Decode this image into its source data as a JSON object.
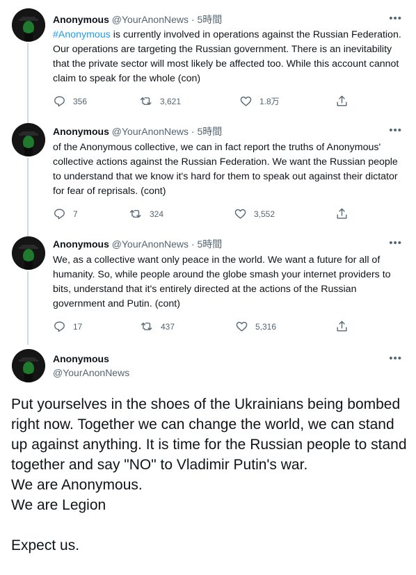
{
  "tweets": [
    {
      "name": "Anonymous",
      "handle": "@YourAnonNews",
      "sep": "·",
      "time": "5時間",
      "hashtag": "#Anonymous",
      "text": " is currently involved in operations against the Russian Federation. Our operations are targeting the Russian government. There is an inevitability that the private sector will most likely be affected too. While this account cannot claim to speak for the whole (con)",
      "replies": "356",
      "retweets": "3,621",
      "likes": "1.8万"
    },
    {
      "name": "Anonymous",
      "handle": "@YourAnonNews",
      "sep": "·",
      "time": "5時間",
      "text": "of the Anonymous collective, we can in fact report the truths of Anonymous' collective actions against the Russian Federation.  We want the Russian people to understand that we know it's hard for them to speak out against their dictator for fear of reprisals. (cont)",
      "replies": "7",
      "retweets": "324",
      "likes": "3,552"
    },
    {
      "name": "Anonymous",
      "handle": "@YourAnonNews",
      "sep": "·",
      "time": "5時間",
      "text": "We, as a collective want only peace in the world.  We want a future for all of humanity.  So, while people around the globe smash your internet providers to bits, understand that it's entirely directed at the actions of the Russian government and Putin. (cont)",
      "replies": "17",
      "retweets": "437",
      "likes": "5,316"
    }
  ],
  "main_tweet": {
    "name": "Anonymous",
    "handle": "@YourAnonNews",
    "lines": [
      "Put yourselves in the shoes of the Ukrainians being bombed right now.  Together we can change the world, we can stand up against anything.  It is time for the Russian people to stand together and say \"NO\" to Vladimir Putin's war.",
      "We are Anonymous.",
      "We are Legion",
      "",
      "Expect us."
    ]
  },
  "icons": {
    "reply": "reply-icon",
    "retweet": "retweet-icon",
    "like": "like-icon",
    "share": "share-icon",
    "more": "more-icon"
  },
  "colors": {
    "link": "#1d9bf0",
    "secondary": "#536471",
    "thread_line": "#cfd9de"
  }
}
